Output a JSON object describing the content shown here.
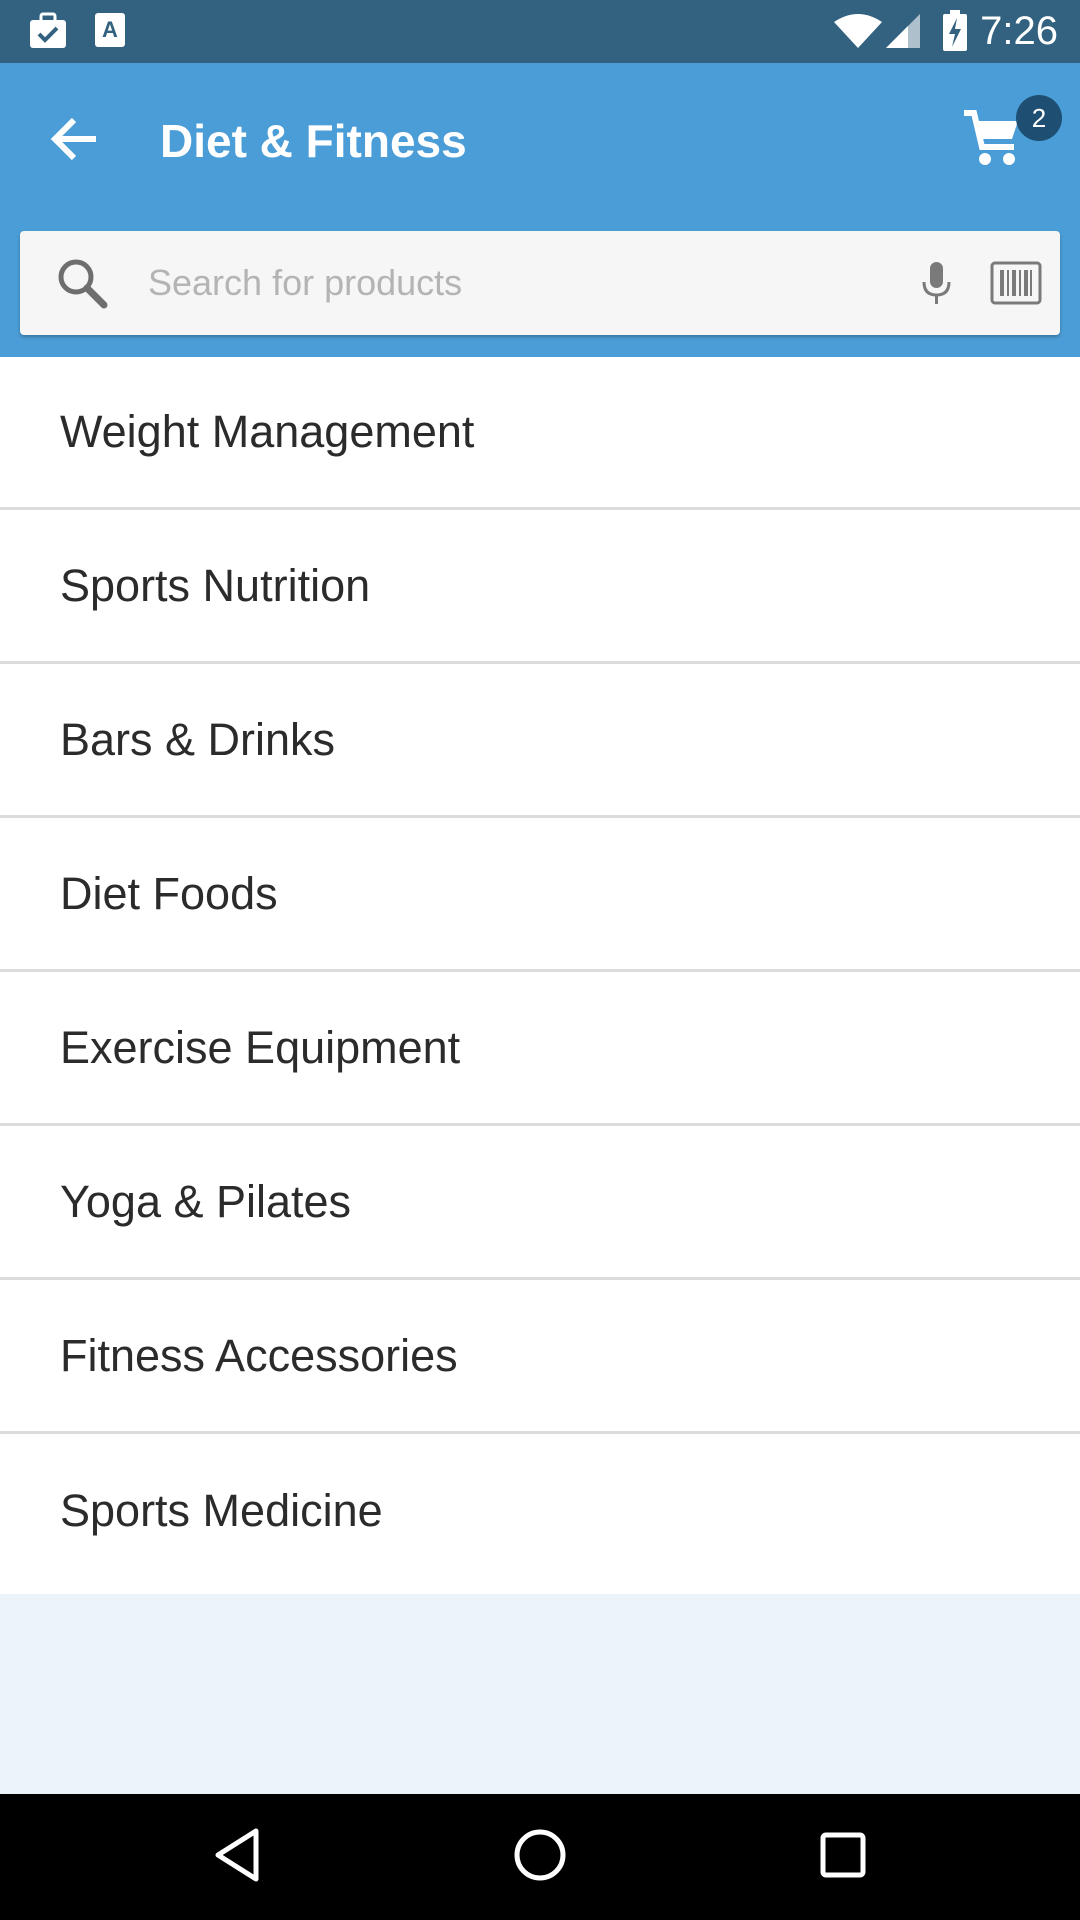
{
  "status_bar": {
    "time": "7:26",
    "left_icons": [
      "briefcase-check-icon",
      "text-a-icon"
    ],
    "right_icons": [
      "wifi-icon",
      "signal-icon",
      "battery-charging-icon"
    ]
  },
  "app_bar": {
    "title": "Diet & Fitness",
    "back_icon": "arrow-back-icon",
    "cart_icon": "cart-icon",
    "cart_count": "2"
  },
  "search": {
    "placeholder": "Search for products",
    "value": "",
    "icons": [
      "search-icon",
      "mic-icon",
      "barcode-icon"
    ]
  },
  "categories": [
    {
      "label": "Weight Management"
    },
    {
      "label": "Sports Nutrition"
    },
    {
      "label": "Bars & Drinks"
    },
    {
      "label": "Diet Foods"
    },
    {
      "label": "Exercise Equipment"
    },
    {
      "label": "Yoga & Pilates"
    },
    {
      "label": "Fitness Accessories"
    },
    {
      "label": "Sports Medicine"
    }
  ],
  "nav_bar": {
    "icons": [
      "back-triangle-icon",
      "home-circle-icon",
      "recents-square-icon"
    ]
  },
  "colors": {
    "status_bar": "#336280",
    "app_bar": "#4a9dd6",
    "badge": "#1e4f72",
    "empty_area": "#ecf3fa"
  }
}
